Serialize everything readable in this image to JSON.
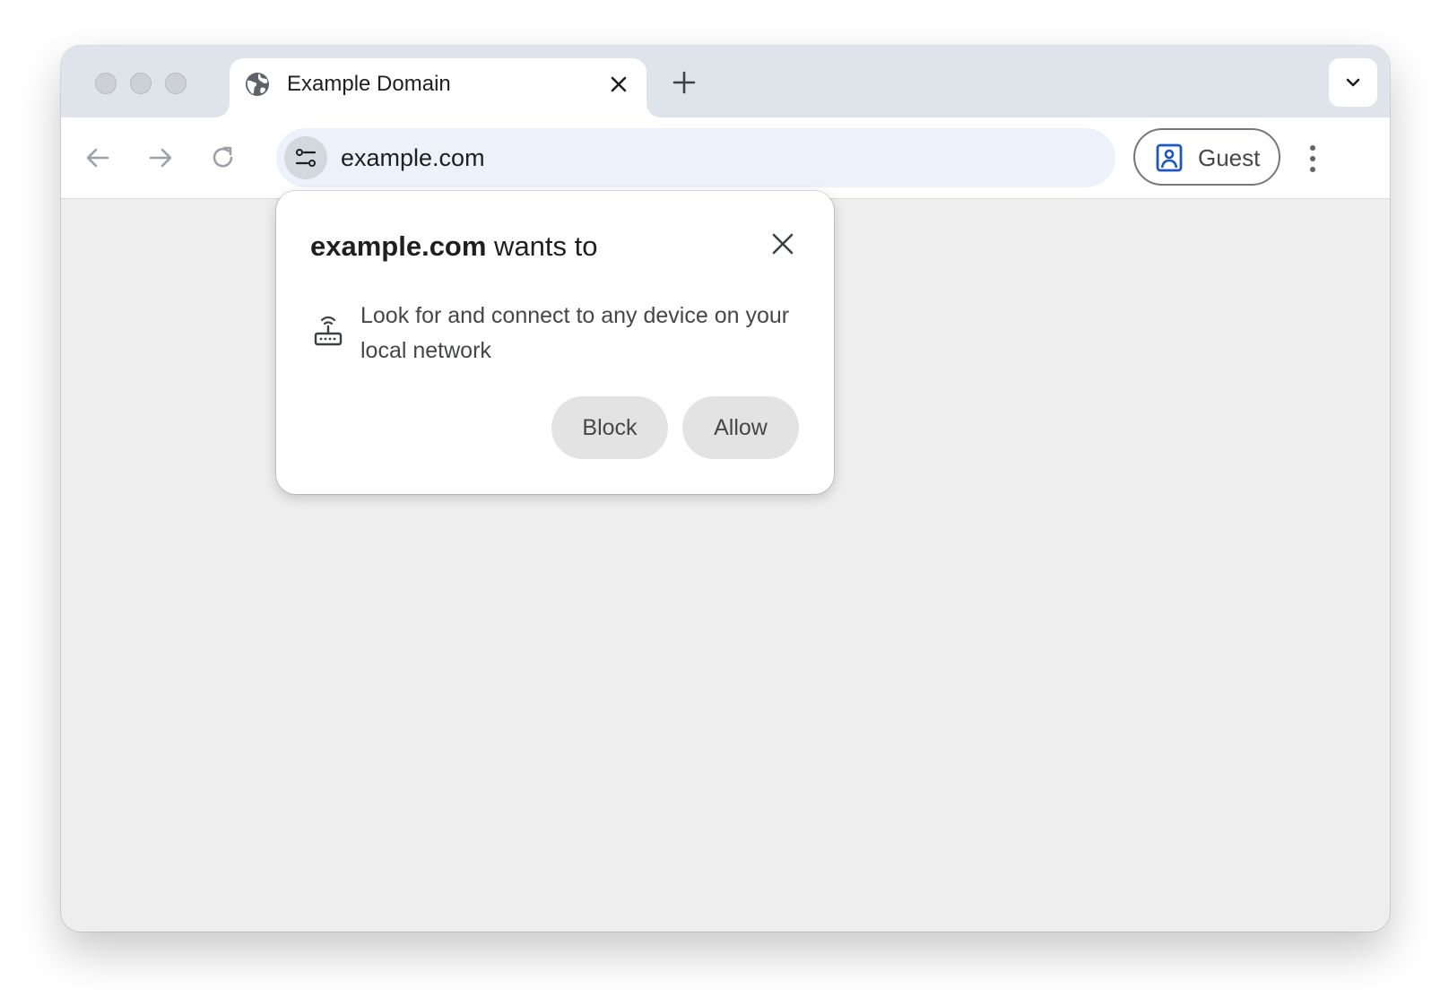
{
  "browser": {
    "tab": {
      "title": "Example Domain",
      "favicon": "globe-icon",
      "close_icon": "close-icon"
    },
    "new_tab_icon": "plus-icon",
    "tab_search_icon": "chevron-down-icon",
    "toolbar": {
      "back_icon": "arrow-left-icon",
      "forward_icon": "arrow-right-icon",
      "reload_icon": "reload-icon",
      "site_info_icon": "tune-icon",
      "url": "example.com",
      "profile": {
        "label": "Guest",
        "icon": "guest-profile-icon",
        "icon_color": "#1a56c9"
      },
      "menu_icon": "more-vert-icon"
    }
  },
  "permission_prompt": {
    "origin": "example.com",
    "title_suffix": " wants to",
    "permission_icon": "router-icon",
    "permission_text": "Look for and connect to any device on your local network",
    "block_label": "Block",
    "allow_label": "Allow",
    "close_icon": "close-icon"
  },
  "colors": {
    "tabstrip": "#dfe3ea",
    "omnibox": "#edf2fa",
    "page_background": "#eeeeee",
    "button_background": "#e3e3e3"
  }
}
